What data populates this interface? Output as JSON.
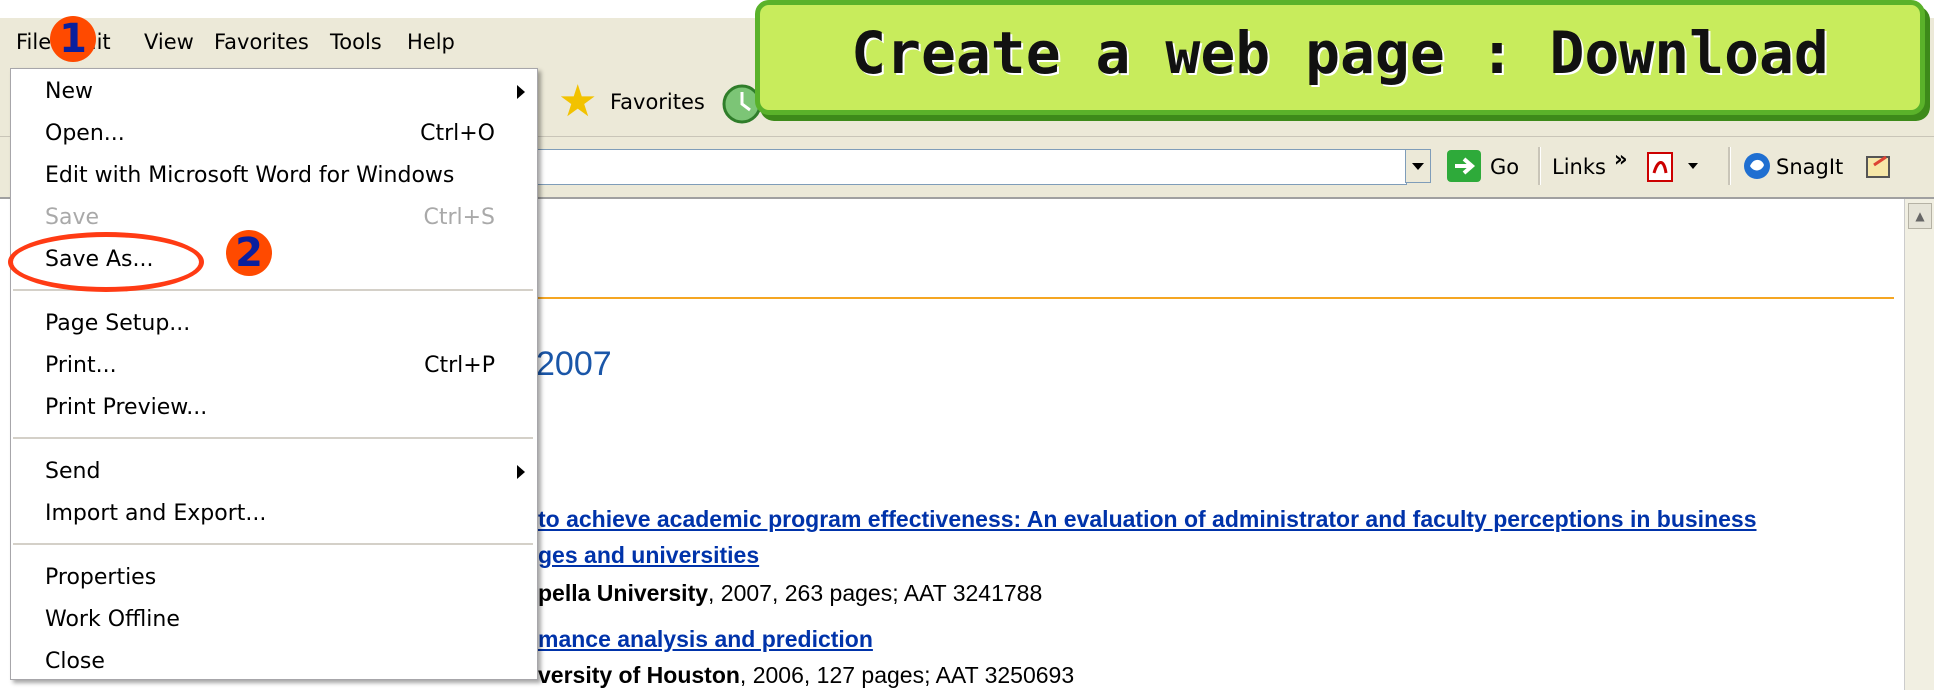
{
  "menubar": {
    "items": [
      "File",
      "Edit",
      "View",
      "Favorites",
      "Tools",
      "Help"
    ]
  },
  "toolbar": {
    "favorites_label": "Favorites",
    "go_label": "Go",
    "links_label": "Links",
    "chevron": "»",
    "snagit_label": "SnagIt"
  },
  "file_menu": {
    "new": "New",
    "open": "Open...",
    "open_shortcut": "Ctrl+O",
    "edit_word": "Edit with Microsoft Word for Windows",
    "save": "Save",
    "save_shortcut": "Ctrl+S",
    "save_as": "Save As...",
    "page_setup": "Page Setup...",
    "print": "Print...",
    "print_shortcut": "Ctrl+P",
    "print_preview": "Print Preview...",
    "send": "Send",
    "import_export": "Import and Export...",
    "properties": "Properties",
    "work_offline": "Work Offline",
    "close": "Close"
  },
  "annotations": {
    "title": "Create a web page : Download",
    "step1": "1",
    "step2": "2",
    "colors": {
      "banner_fill": "#c8ec5c",
      "banner_border": "#5ab22a",
      "badge": "#ff4a00",
      "ring": "#ff3b14"
    }
  },
  "content": {
    "year_heading": "2007",
    "result1_line1": "to achieve academic program effectiveness: An evaluation of administrator and faculty perceptions in business",
    "result1_line2": "ges and universities",
    "result1_meta_bold": "pella University",
    "result1_meta_rest": ", 2007, 263 pages; AAT 3241788",
    "result2_title": "mance analysis and prediction",
    "result2_meta_bold": "versity of Houston",
    "result2_meta_rest": ", 2006, 127 pages; AAT 3250693"
  }
}
